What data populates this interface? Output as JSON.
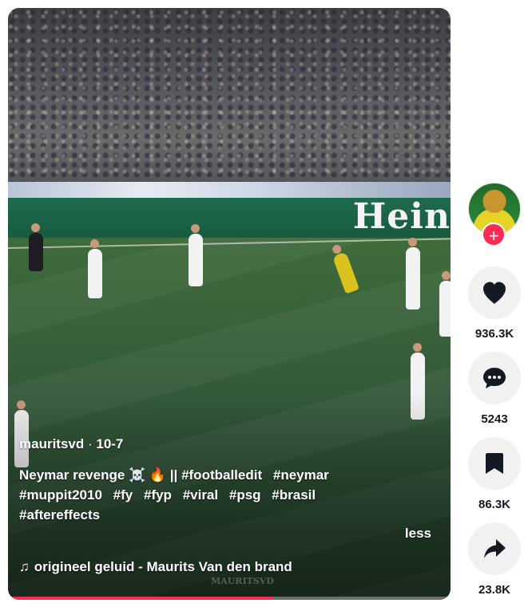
{
  "video": {
    "stadium_board_text": "Hein",
    "author": "mauritsvd",
    "separator": " · ",
    "date": "10-7",
    "caption_text": "Neymar revenge ☠️ 🔥  ||",
    "hashtags": [
      "#footballedit",
      "#neymar",
      "#muppit2010",
      "#fy",
      "#fyp",
      "#viral",
      "#psg",
      "#brasil",
      "#aftereffects"
    ],
    "less_label": "less",
    "music_note": "♫",
    "music_label": "origineel geluid - Maurits Van den brand",
    "watermark": "MAURITSVD",
    "progress_fraction": 0.6,
    "progress_color": "#fe2c55"
  },
  "actions": {
    "follow_symbol": "+",
    "like_count": "936.3K",
    "comment_count": "5243",
    "save_count": "86.3K",
    "share_count": "23.8K"
  },
  "icons": {
    "like": "heart-icon",
    "comment": "comment-bubble-icon",
    "save": "bookmark-icon",
    "share": "share-arrow-icon",
    "follow": "plus-icon",
    "music": "music-note-icon"
  }
}
